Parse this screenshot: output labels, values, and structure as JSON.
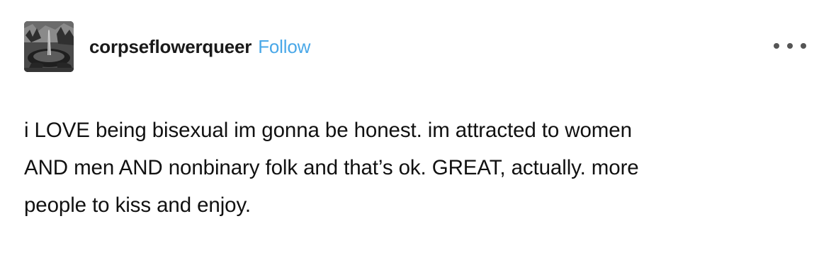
{
  "post": {
    "author": "corpseflowerqueer",
    "follow_label": "Follow",
    "more_icon": "more-horizontal-icon",
    "avatar_icon": "avatar-image",
    "body_lines": [
      "i LOVE being bisexual im gonna be honest. im attracted to women",
      "AND men AND nonbinary folk and that’s ok. GREAT, actually. more",
      "people to kiss and enjoy."
    ]
  },
  "colors": {
    "follow": "#4aa8e8",
    "text": "#111111",
    "background": "#ffffff",
    "more_dots": "#555555"
  }
}
